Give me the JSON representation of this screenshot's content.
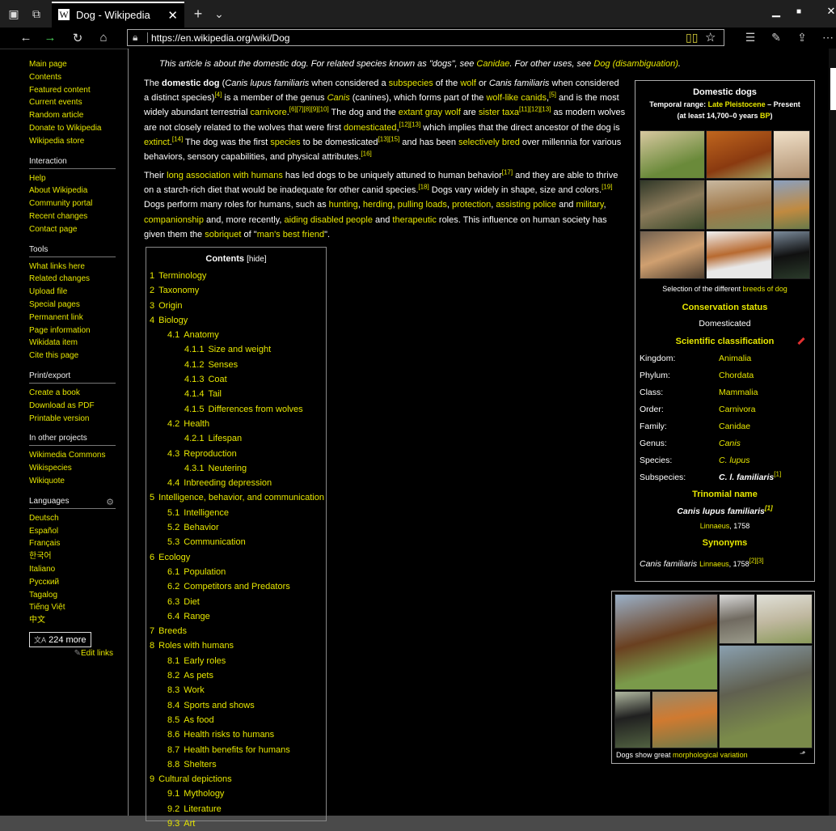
{
  "browser": {
    "tab_title": "Dog - Wikipedia",
    "tab_favicon": "W",
    "url": "https://en.wikipedia.org/wiki/Dog",
    "icons": [
      "tab-set-aside-icon",
      "tab-preview-icon",
      "new-tab-icon",
      "tab-list-icon",
      "minimize-icon",
      "maximize-icon",
      "close-window-icon",
      "back-icon",
      "forward-icon",
      "refresh-icon",
      "home-icon",
      "lock-icon",
      "reading-view-icon",
      "favorite-star-icon",
      "favorites-bar-icon",
      "pen-icon",
      "share-icon",
      "more-icon"
    ]
  },
  "sidebar": {
    "main": [
      "Main page",
      "Contents",
      "Featured content",
      "Current events",
      "Random article",
      "Donate to Wikipedia",
      "Wikipedia store"
    ],
    "interaction_head": "Interaction",
    "interaction": [
      "Help",
      "About Wikipedia",
      "Community portal",
      "Recent changes",
      "Contact page"
    ],
    "tools_head": "Tools",
    "tools": [
      "What links here",
      "Related changes",
      "Upload file",
      "Special pages",
      "Permanent link",
      "Page information",
      "Wikidata item",
      "Cite this page"
    ],
    "print_head": "Print/export",
    "print": [
      "Create a book",
      "Download as PDF",
      "Printable version"
    ],
    "projects_head": "In other projects",
    "projects": [
      "Wikimedia Commons",
      "Wikispecies",
      "Wikiquote"
    ],
    "languages_head": "Languages",
    "languages": [
      "Deutsch",
      "Español",
      "Français",
      "한국어",
      "Italiano",
      "Русский",
      "Tagalog",
      "Tiếng Việt",
      "中文"
    ],
    "more_languages": "224 more",
    "edit_links": "Edit links"
  },
  "article": {
    "hatnote_pre": "This article is about the domestic dog. For related species known as \"dogs\", see ",
    "hatnote_link1": "Canidae",
    "hatnote_mid": ". For other uses, see ",
    "hatnote_link2": "Dog (disambiguation)",
    "hatnote_end": "."
  },
  "toc": {
    "title": "Contents",
    "hide": "[hide]",
    "items": [
      {
        "n": "1",
        "t": "Terminology",
        "lvl": 1
      },
      {
        "n": "2",
        "t": "Taxonomy",
        "lvl": 1
      },
      {
        "n": "3",
        "t": "Origin",
        "lvl": 1
      },
      {
        "n": "4",
        "t": "Biology",
        "lvl": 1
      },
      {
        "n": "4.1",
        "t": "Anatomy",
        "lvl": 2
      },
      {
        "n": "4.1.1",
        "t": "Size and weight",
        "lvl": 3
      },
      {
        "n": "4.1.2",
        "t": "Senses",
        "lvl": 3
      },
      {
        "n": "4.1.3",
        "t": "Coat",
        "lvl": 3
      },
      {
        "n": "4.1.4",
        "t": "Tail",
        "lvl": 3
      },
      {
        "n": "4.1.5",
        "t": "Differences from wolves",
        "lvl": 3
      },
      {
        "n": "4.2",
        "t": "Health",
        "lvl": 2
      },
      {
        "n": "4.2.1",
        "t": "Lifespan",
        "lvl": 3
      },
      {
        "n": "4.3",
        "t": "Reproduction",
        "lvl": 2
      },
      {
        "n": "4.3.1",
        "t": "Neutering",
        "lvl": 3
      },
      {
        "n": "4.4",
        "t": "Inbreeding depression",
        "lvl": 2
      },
      {
        "n": "5",
        "t": "Intelligence, behavior, and communication",
        "lvl": 1
      },
      {
        "n": "5.1",
        "t": "Intelligence",
        "lvl": 2
      },
      {
        "n": "5.2",
        "t": "Behavior",
        "lvl": 2
      },
      {
        "n": "5.3",
        "t": "Communication",
        "lvl": 2
      },
      {
        "n": "6",
        "t": "Ecology",
        "lvl": 1
      },
      {
        "n": "6.1",
        "t": "Population",
        "lvl": 2
      },
      {
        "n": "6.2",
        "t": "Competitors and Predators",
        "lvl": 2
      },
      {
        "n": "6.3",
        "t": "Diet",
        "lvl": 2
      },
      {
        "n": "6.4",
        "t": "Range",
        "lvl": 2
      },
      {
        "n": "7",
        "t": "Breeds",
        "lvl": 1
      },
      {
        "n": "8",
        "t": "Roles with humans",
        "lvl": 1
      },
      {
        "n": "8.1",
        "t": "Early roles",
        "lvl": 2
      },
      {
        "n": "8.2",
        "t": "As pets",
        "lvl": 2
      },
      {
        "n": "8.3",
        "t": "Work",
        "lvl": 2
      },
      {
        "n": "8.4",
        "t": "Sports and shows",
        "lvl": 2
      },
      {
        "n": "8.5",
        "t": "As food",
        "lvl": 2
      },
      {
        "n": "8.6",
        "t": "Health risks to humans",
        "lvl": 2
      },
      {
        "n": "8.7",
        "t": "Health benefits for humans",
        "lvl": 2
      },
      {
        "n": "8.8",
        "t": "Shelters",
        "lvl": 2
      },
      {
        "n": "9",
        "t": "Cultural depictions",
        "lvl": 1
      },
      {
        "n": "9.1",
        "t": "Mythology",
        "lvl": 2
      },
      {
        "n": "9.2",
        "t": "Literature",
        "lvl": 2
      },
      {
        "n": "9.3",
        "t": "Art",
        "lvl": 2
      }
    ]
  },
  "infobox": {
    "title": "Domestic dogs",
    "range_label": "Temporal range: ",
    "range_link": "Late Pleistocene",
    "range_end": " – Present",
    "range2_pre": "(at least 14,700–0 years ",
    "range2_link": "BP",
    "range2_end": ")",
    "caption_pre": "Selection of the different ",
    "caption_link": "breeds of dog",
    "conservation_head": "Conservation status",
    "conservation_value": "Domesticated",
    "classification_head": "Scientific classification",
    "rows": [
      {
        "k": "Kingdom:",
        "v": "Animalia"
      },
      {
        "k": "Phylum:",
        "v": "Chordata"
      },
      {
        "k": "Class:",
        "v": "Mammalia"
      },
      {
        "k": "Order:",
        "v": "Carnivora"
      },
      {
        "k": "Family:",
        "v": "Canidae"
      },
      {
        "k": "Genus:",
        "v": "Canis"
      },
      {
        "k": "Species:",
        "v": "C. lupus"
      },
      {
        "k": "Subspecies:",
        "v": "C. l. familiaris"
      }
    ],
    "trinomial_head": "Trinomial name",
    "trinomial_value": "Canis lupus familiaris",
    "trinomial_author": "Linnaeus",
    "trinomial_year": ", 1758",
    "synonyms_head": "Synonyms",
    "synonym_name": "Canis familiaris",
    "synonym_author": "Linnaeus",
    "synonym_year": ", 1758",
    "synonym_refs": "[2][3]",
    "ref1": "[1]"
  },
  "figure2": {
    "caption_pre": "Dogs show great ",
    "caption_link": "morphological variation"
  }
}
